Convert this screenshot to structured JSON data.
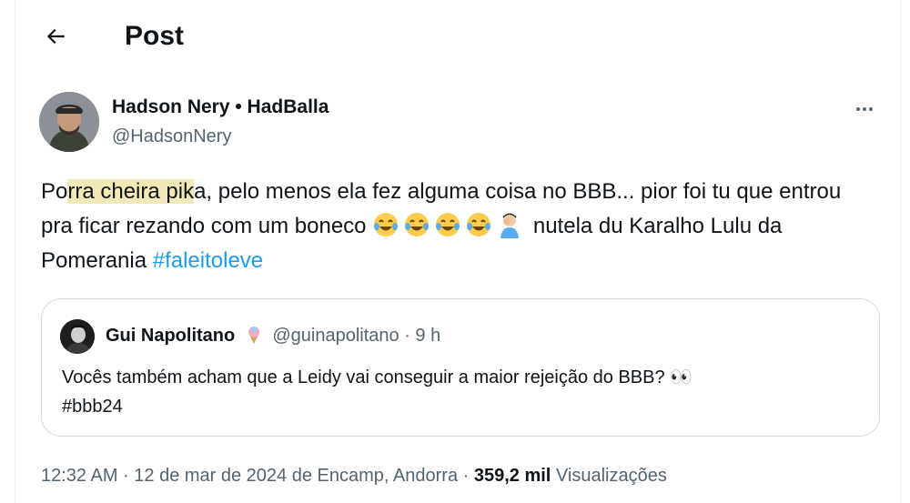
{
  "header": {
    "title": "Post",
    "back_icon": "arrow-left-icon"
  },
  "author": {
    "display_name": "Hadson Nery • HadBalla",
    "handle": "@HadsonNery"
  },
  "tweet": {
    "text_prefix_1": "Po",
    "text_highlight": "rra cheira pik",
    "text_after_highlight": "a, pelo menos ela fez alguma coisa no BBB... pior foi tu que entrou pra ficar rezando com um boneco ",
    "emojis": [
      "laughing-crying-emoji",
      "laughing-crying-emoji",
      "laughing-crying-emoji",
      "laughing-crying-emoji",
      "person-facepalm-emoji"
    ],
    "text_after_emojis": " nutela du Karalho Lulu da Pomerania ",
    "hashtag": "#faleitoleve"
  },
  "quote": {
    "name": "Gui Napolitano",
    "badge_icon": "ice-cream-emoji",
    "handle": "@guinapolitano",
    "separator": " · ",
    "time": "9 h",
    "text_line1": "Vocês também acham que a Leidy vai conseguir a maior rejeição do BBB? 👀",
    "text_line2": "#bbb24"
  },
  "footer": {
    "time": "12:32 AM · 12 de mar de 2024 de Encamp, Andorra · ",
    "views_count": "359,2 mil",
    "views_label": " Visualizações"
  },
  "colors": {
    "link": "#1d9bf0",
    "text": "#0f1419",
    "muted": "#536471",
    "border": "#cfd9de"
  }
}
